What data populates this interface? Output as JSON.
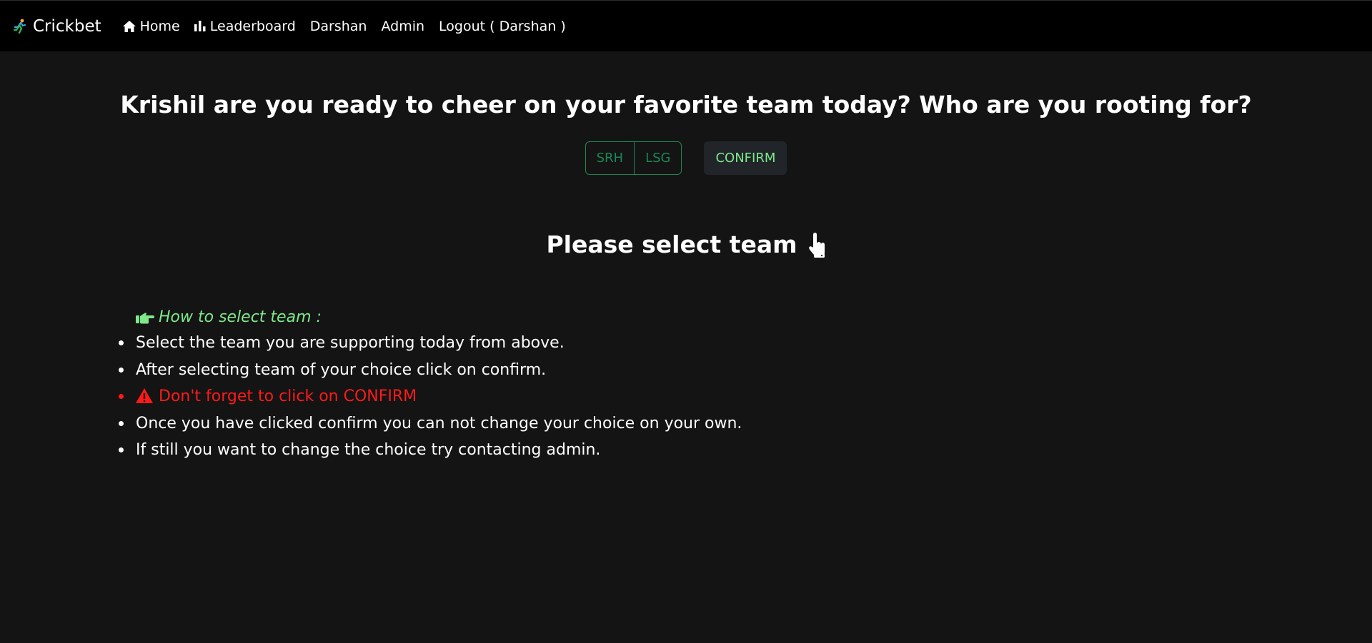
{
  "nav": {
    "brand": "Crickbet",
    "items": [
      {
        "label": "Home",
        "icon": "home-icon"
      },
      {
        "label": "Leaderboard",
        "icon": "bar-chart-icon"
      },
      {
        "label": "Darshan"
      },
      {
        "label": "Admin"
      },
      {
        "label": "Logout ( Darshan )"
      }
    ]
  },
  "main": {
    "headline": "Krishil are you ready to cheer on your favorite team today? Who are you rooting for?",
    "teams": [
      "SRH",
      "LSG"
    ],
    "confirm_label": "CONFIRM",
    "select_title": "Please select team",
    "howto_title": "How to select team :",
    "instructions": [
      "Select the team you are supporting today from above.",
      "After selecting team of your choice click on confirm.",
      "Don't forget to click on CONFIRM",
      "Once you have clicked confirm you can not change your choice on your own.",
      "If still you want to change the choice try contacting admin."
    ]
  },
  "colors": {
    "background": "#141414",
    "navbar": "#000000",
    "team_outline": "#198754",
    "confirm_text": "#7ee88a",
    "warning": "#ff1a1a"
  }
}
